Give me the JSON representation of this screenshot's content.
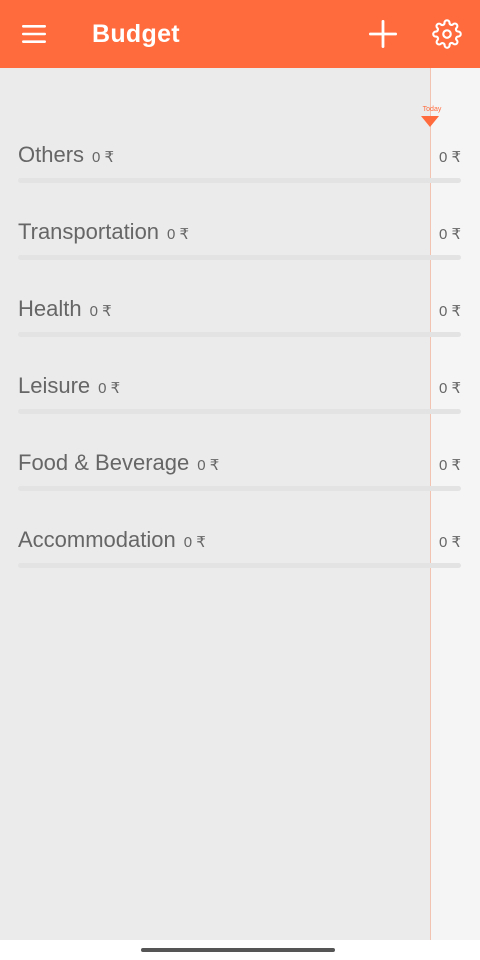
{
  "app_bar": {
    "title": "Budget",
    "menu_icon": "hamburger-menu-icon",
    "add_icon": "plus-icon",
    "settings_icon": "gear-icon",
    "color": "#ff6b3d"
  },
  "timeline": {
    "today_label": "Today",
    "marker_color": "#ff6b3d"
  },
  "categories": [
    {
      "name": "Others",
      "amount": "0 ₹",
      "total": "0 ₹"
    },
    {
      "name": "Transportation",
      "amount": "0 ₹",
      "total": "0 ₹"
    },
    {
      "name": "Health",
      "amount": "0 ₹",
      "total": "0 ₹"
    },
    {
      "name": "Leisure",
      "amount": "0 ₹",
      "total": "0 ₹"
    },
    {
      "name": "Food & Beverage",
      "amount": "0 ₹",
      "total": "0 ₹"
    },
    {
      "name": "Accommodation",
      "amount": "0 ₹",
      "total": "0 ₹"
    }
  ]
}
